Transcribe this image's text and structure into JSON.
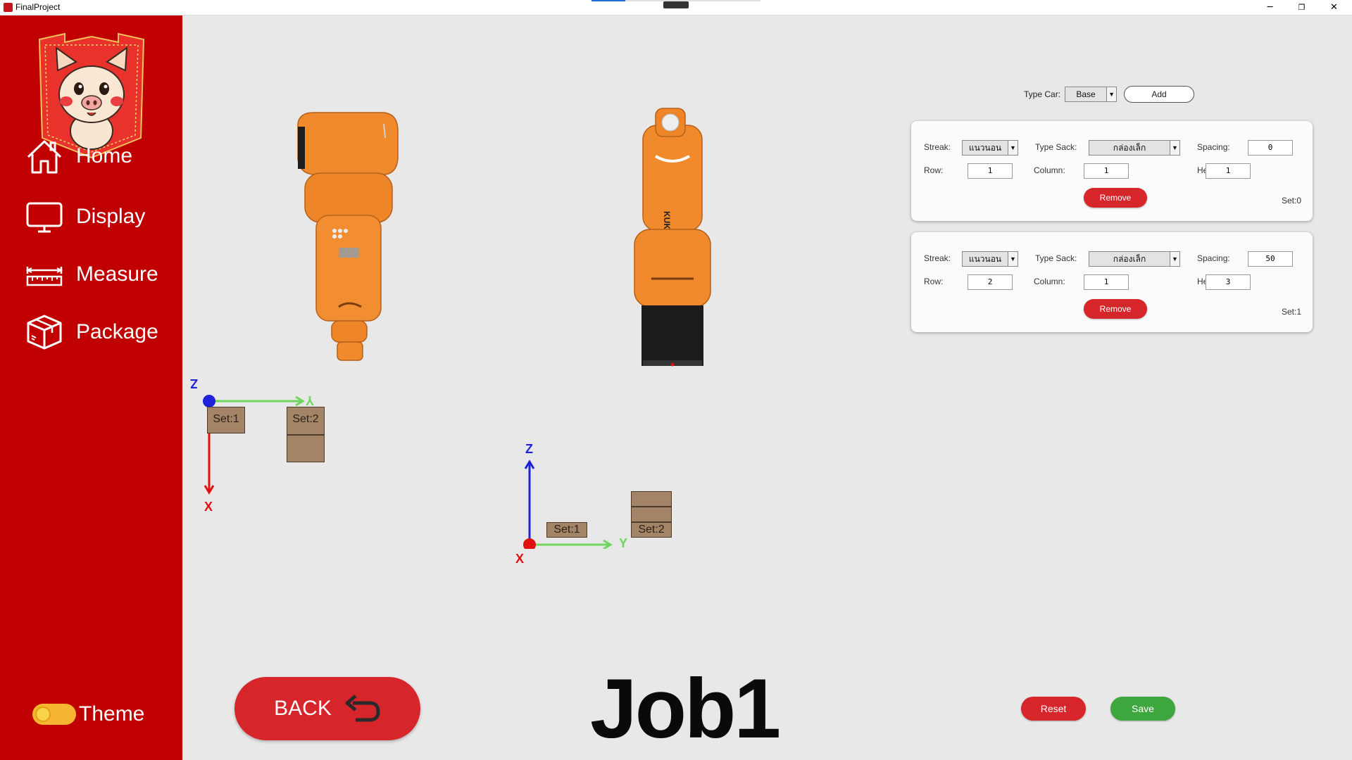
{
  "window": {
    "title": "FinalProject",
    "minimize": "─",
    "restore": "❐",
    "close": "✕"
  },
  "sidebar": {
    "items": [
      {
        "label": "Home",
        "icon": "home-icon"
      },
      {
        "label": "Display",
        "icon": "monitor-icon"
      },
      {
        "label": "Measure",
        "icon": "ruler-icon"
      },
      {
        "label": "Package",
        "icon": "package-icon"
      }
    ],
    "theme_label": "Theme"
  },
  "type_car": {
    "label": "Type Car:",
    "value": "Base",
    "add_label": "Add"
  },
  "sets": [
    {
      "streak_label": "Streak:",
      "streak": "แนวนอน",
      "sack_label": "Type Sack:",
      "sack": "กล่องเล็ก",
      "spacing_label": "Spacing:",
      "spacing": "0",
      "row_label": "Row:",
      "row": "1",
      "column_label": "Column:",
      "column": "1",
      "height_label": "Height:",
      "height": "1",
      "remove_label": "Remove",
      "tag": "Set:0"
    },
    {
      "streak_label": "Streak:",
      "streak": "แนวนอน",
      "sack_label": "Type Sack:",
      "sack": "กล่องเล็ก",
      "spacing_label": "Spacing:",
      "spacing": "50",
      "row_label": "Row:",
      "row": "2",
      "column_label": "Column:",
      "column": "1",
      "height_label": "Height:",
      "height": "3",
      "remove_label": "Remove",
      "tag": "Set:1"
    }
  ],
  "top_view": {
    "axis_z": "Z",
    "axis_y": "Y",
    "axis_x": "X",
    "box1": "Set:1",
    "box2": "Set:2"
  },
  "side_view": {
    "axis_z": "Z",
    "axis_y": "Y",
    "axis_x": "X",
    "box1": "Set:1",
    "box2": "Set:2"
  },
  "robot_brand": "KUKA",
  "back_label": "BACK",
  "job_title": "Job1",
  "reset_label": "Reset",
  "save_label": "Save",
  "colors": {
    "sidebar": "#c00000",
    "button_red": "#d7262b",
    "save_green": "#3ea63e",
    "robot_orange": "#f08a2c",
    "axis_x": "#e01010",
    "axis_y": "#6ed65a",
    "axis_z": "#1e22d8"
  }
}
